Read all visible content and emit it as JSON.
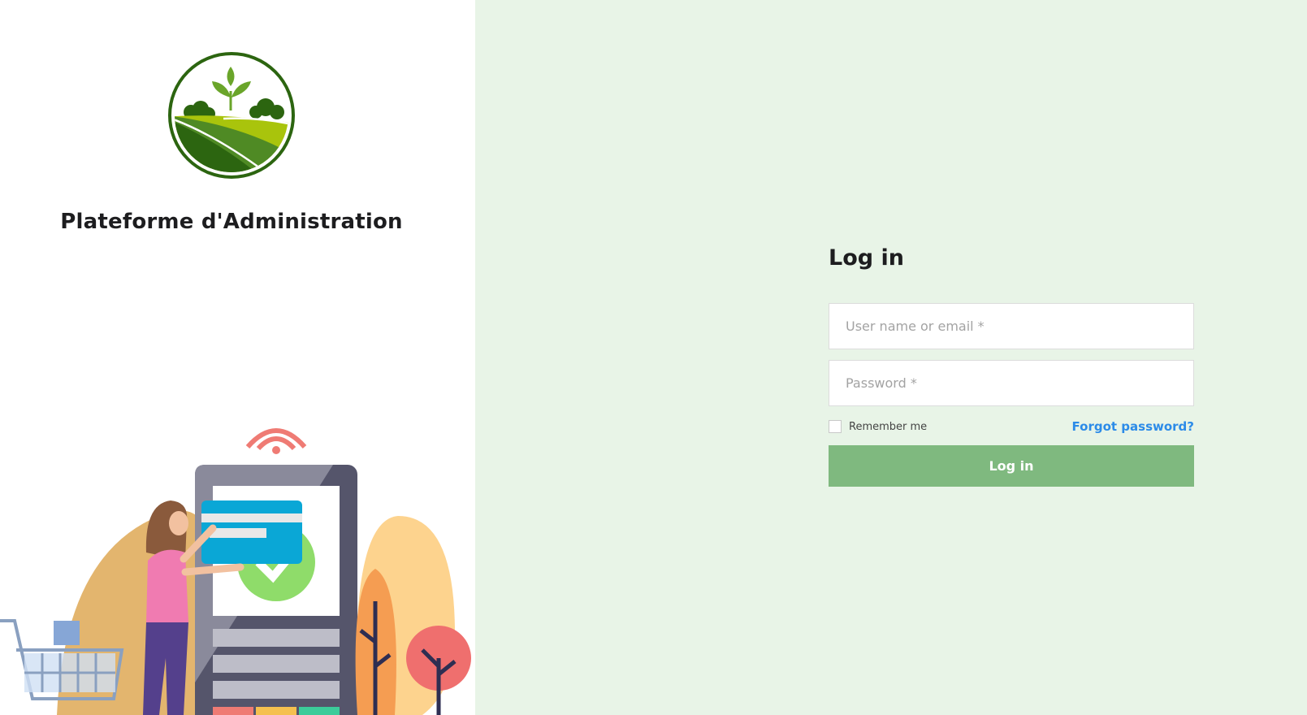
{
  "branding": {
    "logo_icon": "farm-field-sprout-logo",
    "app_title": "Plateforme d'Administration",
    "illustration": "shopper-paying-with-card-at-terminal"
  },
  "login": {
    "title": "Log in",
    "username_placeholder": "User name or email *",
    "username_value": "",
    "password_placeholder": "Password *",
    "password_value": "",
    "remember_label": "Remember me",
    "remember_checked": false,
    "forgot_label": "Forgot password?",
    "submit_label": "Log in"
  },
  "colors": {
    "page_background": "#e8f4e7",
    "left_panel_background": "#ffffff",
    "logo_green": "#2f6a0f",
    "login_button": "#7fb97f",
    "link_blue": "#2c8be8"
  }
}
